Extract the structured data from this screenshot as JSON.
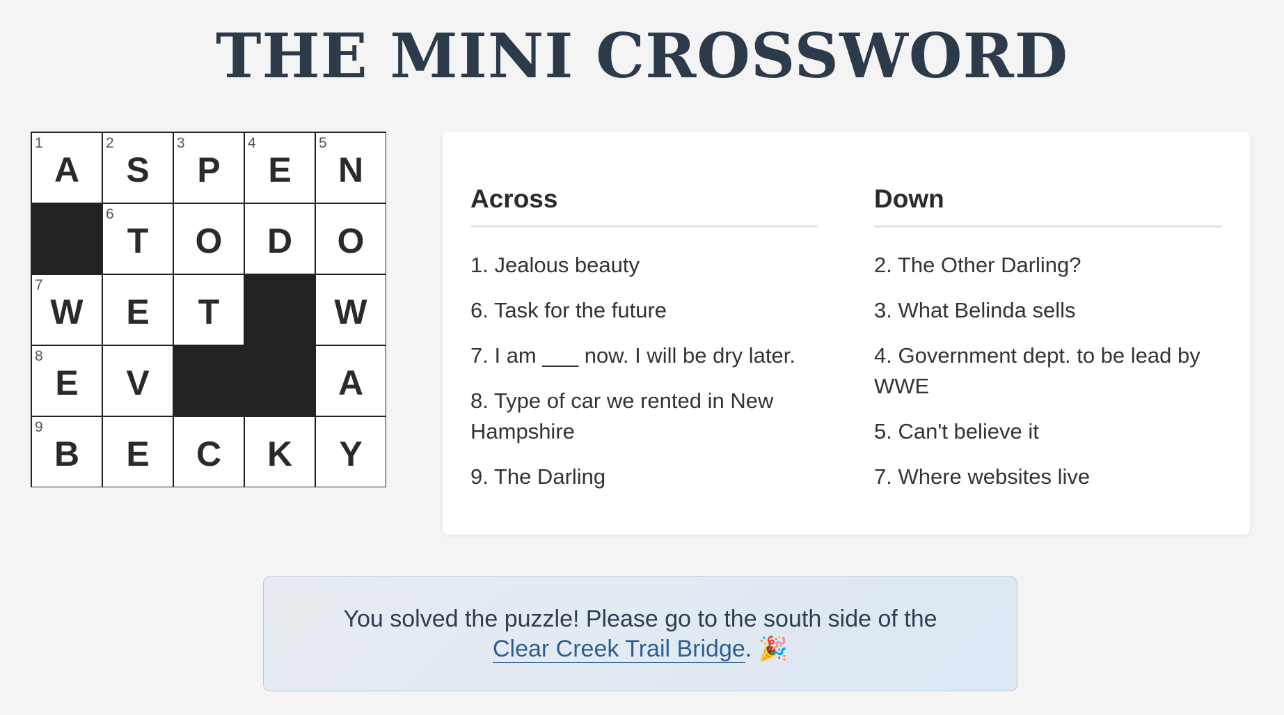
{
  "title": "THE MINI CROSSWORD",
  "grid": {
    "rows": [
      [
        {
          "n": "1",
          "l": "A"
        },
        {
          "n": "2",
          "l": "S"
        },
        {
          "n": "3",
          "l": "P"
        },
        {
          "n": "4",
          "l": "E"
        },
        {
          "n": "5",
          "l": "N"
        }
      ],
      [
        {
          "black": true
        },
        {
          "n": "6",
          "l": "T"
        },
        {
          "n": "",
          "l": "O"
        },
        {
          "n": "",
          "l": "D"
        },
        {
          "n": "",
          "l": "O"
        }
      ],
      [
        {
          "n": "7",
          "l": "W"
        },
        {
          "n": "",
          "l": "E"
        },
        {
          "n": "",
          "l": "T"
        },
        {
          "black": true
        },
        {
          "n": "",
          "l": "W"
        }
      ],
      [
        {
          "n": "8",
          "l": "E"
        },
        {
          "n": "",
          "l": "V"
        },
        {
          "black": true
        },
        {
          "black": true
        },
        {
          "n": "",
          "l": "A"
        }
      ],
      [
        {
          "n": "9",
          "l": "B"
        },
        {
          "n": "",
          "l": "E"
        },
        {
          "n": "",
          "l": "C"
        },
        {
          "n": "",
          "l": "K"
        },
        {
          "n": "",
          "l": "Y"
        }
      ]
    ]
  },
  "clues": {
    "across_heading": "Across",
    "down_heading": "Down",
    "across": [
      "1. Jealous beauty",
      "6. Task for the future",
      "7. I am ___ now. I will be dry later.",
      "8. Type of car we rented in New Hampshire",
      "9. The Darling"
    ],
    "down": [
      "2. The Other Darling?",
      "3. What Belinda sells",
      "4. Government dept. to be lead by WWE",
      "5. Can't believe it",
      "7. Where websites live"
    ]
  },
  "banner": {
    "text_before": "You solved the puzzle! Please go to the south side of the ",
    "link_text": "Clear Creek Trail Bridge",
    "text_after": ". 🎉"
  }
}
